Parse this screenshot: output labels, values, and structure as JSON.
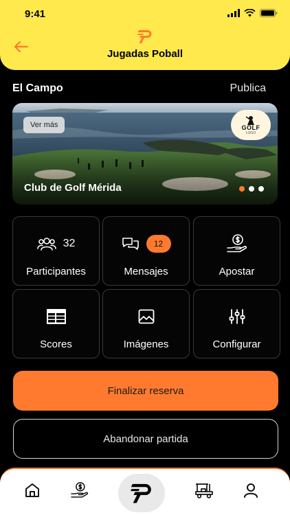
{
  "status_bar": {
    "time": "9:41"
  },
  "header": {
    "title": "Jugadas Poball"
  },
  "section": {
    "title": "El Campo",
    "status": "Publica"
  },
  "banner": {
    "see_more_label": "Ver más",
    "club_name": "Club de Golf Mérida",
    "logo_text": "GOLF",
    "logo_subtext": "LOGO",
    "slide_count": 3,
    "active_slide": 1
  },
  "tiles": [
    {
      "label": "Participantes",
      "count": "32",
      "icon": "users-icon"
    },
    {
      "label": "Mensajes",
      "badge": "12",
      "icon": "chat-icon"
    },
    {
      "label": "Apostar",
      "icon": "money-hand-icon"
    },
    {
      "label": "Scores",
      "icon": "table-icon"
    },
    {
      "label": "Imágenes",
      "icon": "image-icon"
    },
    {
      "label": "Configurar",
      "icon": "sliders-icon"
    }
  ],
  "actions": {
    "primary_label": "Finalizar reserva",
    "secondary_label": "Abandonar partida"
  },
  "bottom_nav": [
    {
      "name": "home",
      "icon": "home-icon"
    },
    {
      "name": "bets",
      "icon": "money-hand-icon"
    },
    {
      "name": "poball",
      "icon": "poball-logo-icon",
      "active": true
    },
    {
      "name": "golf-cart",
      "icon": "golf-cart-icon"
    },
    {
      "name": "profile",
      "icon": "user-icon"
    }
  ],
  "colors": {
    "header_bg": "#FFE94D",
    "accent": "#FF7A2E",
    "background": "#000000"
  }
}
